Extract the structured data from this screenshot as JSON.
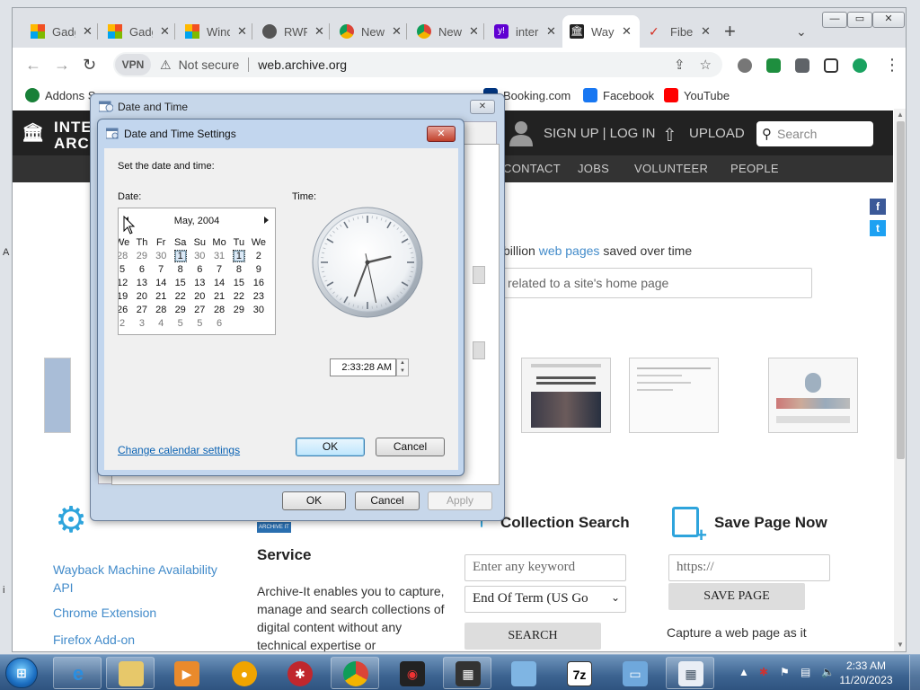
{
  "browser": {
    "tabs": [
      {
        "title": "Gadgets"
      },
      {
        "title": "Gadgets"
      },
      {
        "title": "Windows"
      },
      {
        "title": "RWF"
      },
      {
        "title": "New Tab"
      },
      {
        "title": "New Tab"
      },
      {
        "title": "internet"
      },
      {
        "title": "Wayback"
      },
      {
        "title": "Fiber"
      }
    ],
    "tab_close": "✕",
    "new_tab": "+",
    "window_controls": {
      "minimize": "—",
      "maximize": "▭",
      "close": "✕"
    },
    "vpn_label": "VPN",
    "security_label": "Not secure",
    "url": "web.archive.org",
    "bookmarks": [
      {
        "label": "Addons S"
      },
      {
        "label": "Booking.com"
      },
      {
        "label": "Facebook"
      },
      {
        "label": "YouTube"
      }
    ]
  },
  "archive": {
    "logo_text": "INTERNET ARCHIVE",
    "signup": "SIGN UP | LOG IN",
    "upload": "UPLOAD",
    "search_placeholder": "Search",
    "nav": [
      "CONTACT",
      "JOBS",
      "VOLUNTEER",
      "PEOPLE"
    ],
    "wayback_prefix": "billion",
    "wayback_link": "web pages",
    "wayback_suffix": "saved over time",
    "wayback_input_placeholder": "related to a site's home page",
    "tools_links": [
      "Wayback Machine Availability API",
      "Chrome Extension",
      "Firefox Add-on"
    ],
    "archiveit_badge": "ARCHIVE IT",
    "service_heading": "Service",
    "service_text": "Archive-It enables you to capture, manage and search collections of digital content without any technical expertise or",
    "collection_heading": "Collection Search",
    "collection_input_placeholder": "Enter any keyword",
    "collection_select": "End Of Term (US Go",
    "collection_button": "SEARCH",
    "savepage_heading": "Save Page Now",
    "savepage_input_placeholder": "https://",
    "savepage_button": "SAVE PAGE",
    "capture_text": "Capture a web page as it",
    "social": {
      "facebook": "f",
      "twitter": "t"
    }
  },
  "dialog_outer": {
    "title": "Date and Time",
    "ok": "OK",
    "cancel": "Cancel",
    "apply": "Apply"
  },
  "dialog_inner": {
    "title": "Date and Time Settings",
    "instruction": "Set the date and time:",
    "date_label": "Date:",
    "time_label": "Time:",
    "month": "May, 2004",
    "weekdays": [
      "We",
      "Th",
      "Fr",
      "Sa",
      "Su",
      "Mo",
      "Tu",
      "We"
    ],
    "weeks": [
      [
        "28",
        "29",
        "30",
        "1",
        "30",
        "31",
        "1",
        "2"
      ],
      [
        "5",
        "6",
        "7",
        "8",
        "6",
        "7",
        "8",
        "9"
      ],
      [
        "12",
        "13",
        "14",
        "15",
        "13",
        "14",
        "15",
        "16"
      ],
      [
        "19",
        "20",
        "21",
        "22",
        "20",
        "21",
        "22",
        "23"
      ],
      [
        "26",
        "27",
        "28",
        "29",
        "27",
        "28",
        "29",
        "30"
      ],
      [
        "2",
        "3",
        "4",
        "5",
        "5",
        "6",
        "",
        ""
      ]
    ],
    "time_value": "2:33:28 AM",
    "clock": {
      "hour": 2,
      "minute": 33,
      "second": 28
    },
    "change_link": "Change calendar settings",
    "ok": "OK",
    "cancel": "Cancel"
  },
  "taskbar": {
    "start": "⊞",
    "time": "2:33 AM",
    "date": "11/20/2023"
  }
}
